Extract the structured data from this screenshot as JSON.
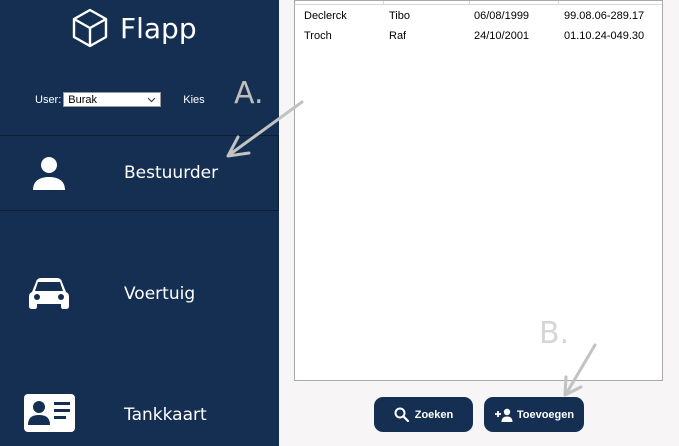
{
  "app": {
    "name": "Flapp"
  },
  "user": {
    "label": "User:",
    "selected": "Burak",
    "kies": "Kies"
  },
  "nav": [
    {
      "label": "Bestuurder",
      "icon": "person-icon"
    },
    {
      "label": "Voertuig",
      "icon": "car-icon"
    },
    {
      "label": "Tankkaart",
      "icon": "id-card-icon"
    }
  ],
  "table": {
    "rows": [
      [
        "Declerck",
        "Tibo",
        "06/08/1999",
        "99.08.06-289.17"
      ],
      [
        "Troch",
        "Raf",
        "24/10/2001",
        "01.10.24-049.30"
      ]
    ]
  },
  "buttons": {
    "search": "Zoeken",
    "add": "Toevoegen"
  },
  "annotations": {
    "a": "A.",
    "b": "B."
  },
  "colors": {
    "sidebar": "#142f52",
    "button": "#142f52",
    "background": "#f7f5f5"
  }
}
